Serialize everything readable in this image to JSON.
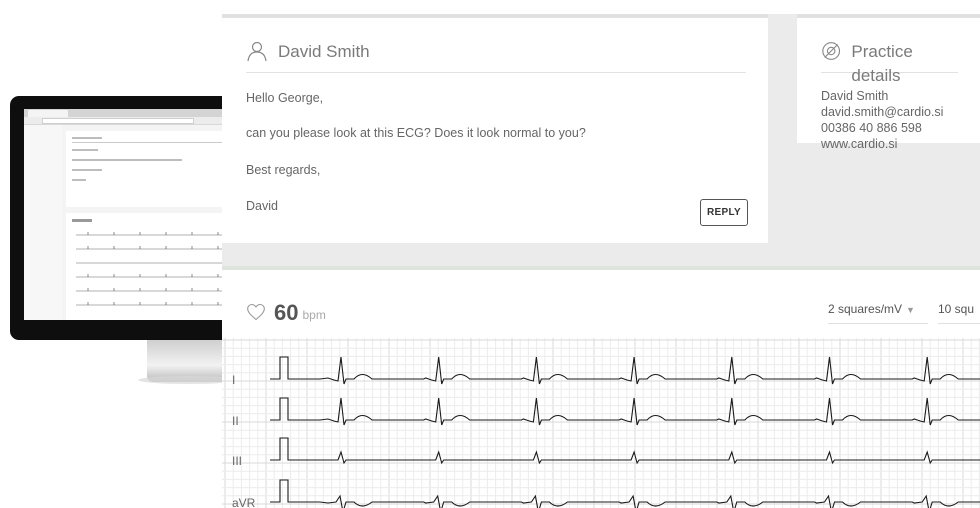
{
  "message_card": {
    "sender": "David Smith",
    "lines": [
      "Hello George,",
      "can you please look at this ECG? Does it look normal to you?",
      "Best regards,",
      "David"
    ],
    "reply_label": "REPLY"
  },
  "practice_card": {
    "title": "Practice details",
    "lines": [
      "David Smith",
      "david.smith@cardio.si",
      "00386 40 886 598",
      "www.cardio.si"
    ]
  },
  "ecg_panel": {
    "heart_rate": "60",
    "heart_rate_unit": "bpm",
    "scale_select": "2 squares/mV",
    "speed_select": "10 squ",
    "leads": [
      "I",
      "II",
      "III",
      "aVR"
    ]
  },
  "colors": {
    "panel_background": "#ebebeb",
    "card_background": "#ffffff",
    "grid_minor": "#ececec",
    "grid_major": "#dadada",
    "trace": "#1a1a1a"
  }
}
